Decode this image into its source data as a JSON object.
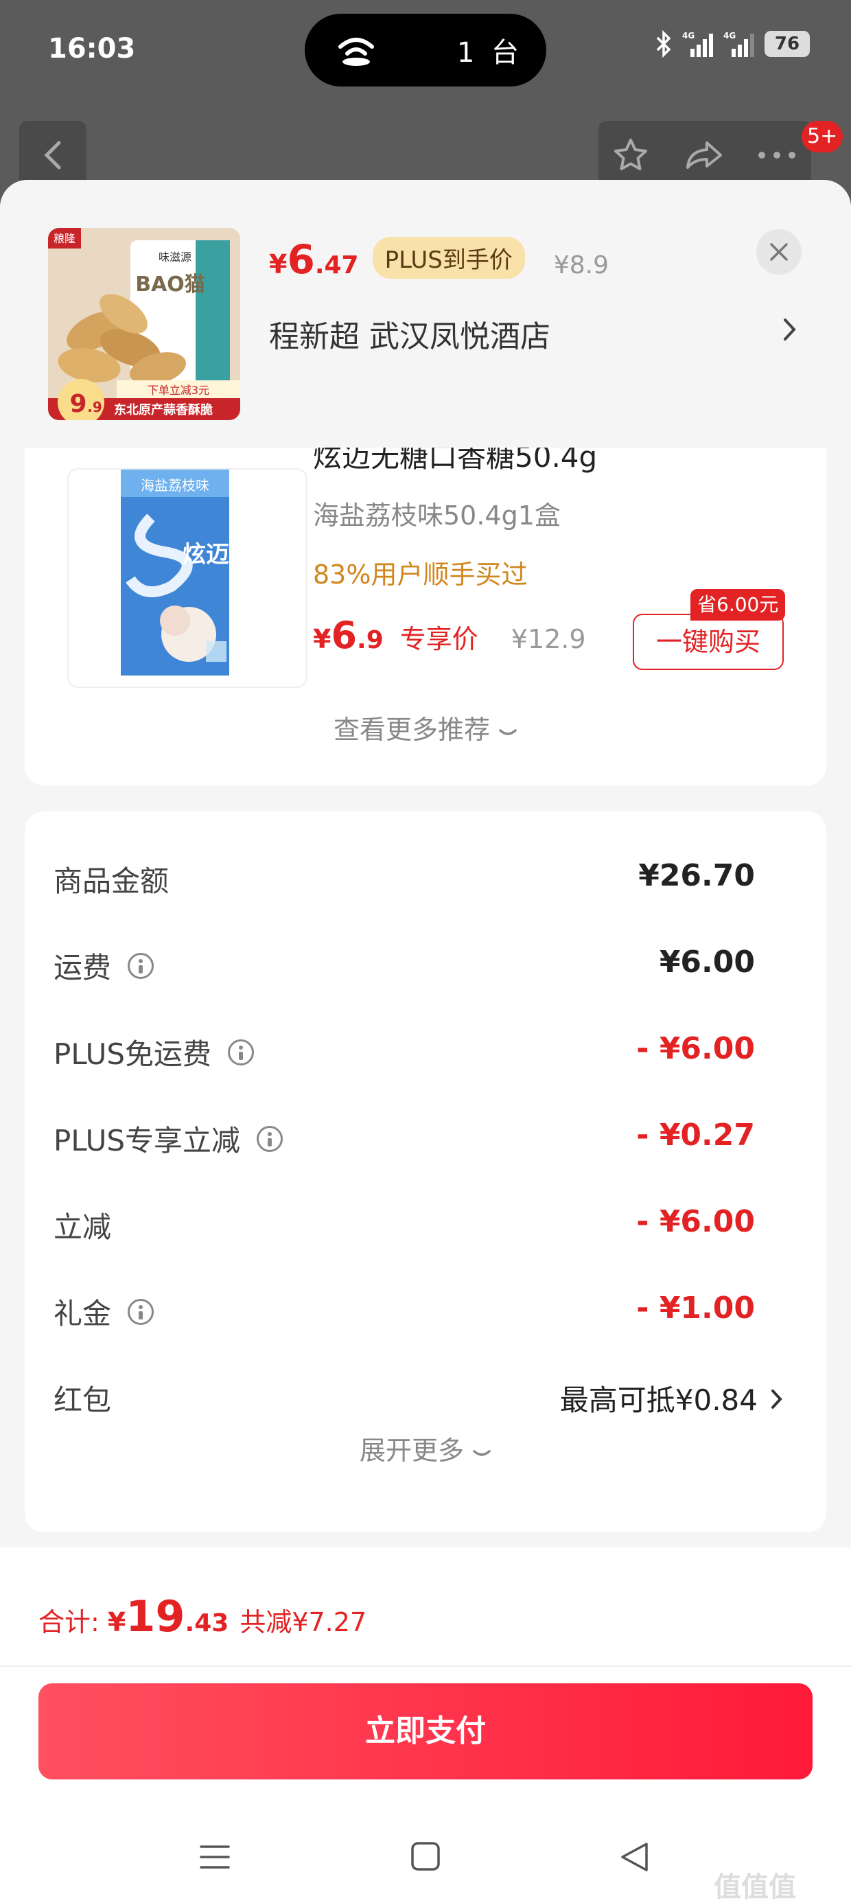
{
  "status_bar": {
    "time": "16:03",
    "island_text": "1 台",
    "battery": "76",
    "network_1": "4G",
    "network_2": "4G"
  },
  "page_nav": {
    "notification_count": "5+"
  },
  "header": {
    "price_currency": "¥",
    "price_int": "6",
    "price_dec": ".47",
    "plus_tag": "PLUS到手价",
    "original_price": "¥8.9",
    "address": "程新超  武汉凤悦酒店",
    "product_image_text": {
      "brand": "粮隆",
      "label": "味滋源",
      "pack": "BAO猫",
      "promo": "下单立减3元",
      "slogan": "东北原产蒜香酥脆",
      "price": "9",
      "price_dec": ".9"
    }
  },
  "recommendation": {
    "title": "炫迈无糖口香糖50.4g",
    "spec": "海盐荔枝味50.4g1盒",
    "social_proof": "83%用户顺手买过",
    "price_currency": "¥",
    "price_int": "6",
    "price_dec": ".9",
    "price_label": "专享价",
    "original_price": "¥12.9",
    "buy_button": "一键购买",
    "save_tag": "省6.00元",
    "image_text": {
      "flavor": "海盐荔枝味",
      "brand": "炫迈"
    },
    "more_link": "查看更多推荐"
  },
  "summary": {
    "rows": [
      {
        "label": "商品金额",
        "value": "¥26.70",
        "info": false,
        "red": false
      },
      {
        "label": "运费",
        "value": "¥6.00",
        "info": true,
        "red": false
      },
      {
        "label": "PLUS免运费",
        "value": "- ¥6.00",
        "info": true,
        "red": true
      },
      {
        "label": "PLUS专享立减",
        "value": "- ¥0.27",
        "info": true,
        "red": true
      },
      {
        "label": "立减",
        "value": "- ¥6.00",
        "info": false,
        "red": true
      },
      {
        "label": "礼金",
        "value": "- ¥1.00",
        "info": true,
        "red": true
      },
      {
        "label": "红包",
        "value": "最高可抵¥0.84",
        "info": false,
        "red": false
      }
    ],
    "expand_link": "展开更多"
  },
  "footer": {
    "total_label": "合计:",
    "total_currency": "¥",
    "total_int": "19",
    "total_dec": ".43",
    "total_saved": "共减¥7.27",
    "pay_button": "立即支付"
  },
  "watermark": "值值值",
  "colors": {
    "accent_red": "#e32224",
    "plus_gold": "#f9e2a9",
    "social_orange": "#d0871e"
  },
  "icons": [
    "wifi-icon",
    "bluetooth-icon",
    "signal-icon",
    "back-arrow-icon",
    "star-icon",
    "share-icon",
    "more-icon",
    "close-icon",
    "chevron-right-icon",
    "chevron-down-icon",
    "info-icon",
    "menu-icon",
    "home-icon",
    "back-triangle-icon"
  ]
}
